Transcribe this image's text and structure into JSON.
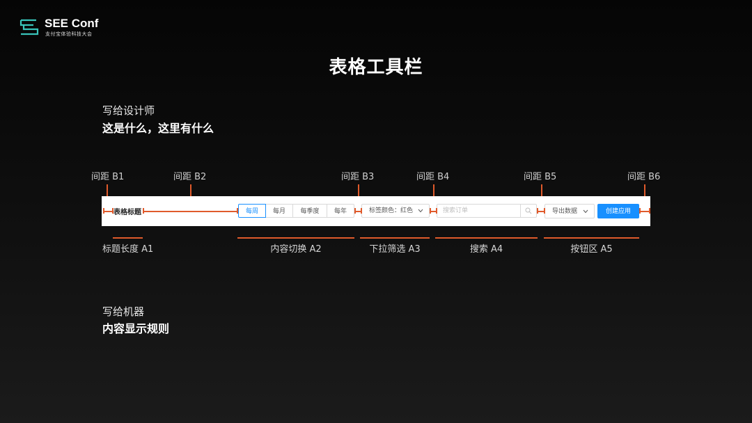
{
  "brand": {
    "name": "SEE Conf",
    "subtitle": "支付宝体验科技大会"
  },
  "page_title": "表格工具栏",
  "section1": {
    "caption": "写给设计师",
    "heading": "这是什么，这里有什么"
  },
  "section2": {
    "caption": "写给机器",
    "heading": "内容显示规则"
  },
  "spacing_labels": [
    "间距 B1",
    "间距 B2",
    "间距 B3",
    "间距 B4",
    "间距 B5",
    "间距 B6"
  ],
  "area_labels": [
    "标题长度 A1",
    "内容切换 A2",
    "下拉筛选 A3",
    "搜索 A4",
    "按钮区 A5"
  ],
  "toolbar": {
    "title": "表格标题",
    "segments": [
      "每周",
      "每月",
      "每季度",
      "每年"
    ],
    "active_segment": "每周",
    "filter_label": "标签颜色：",
    "filter_value": "红色",
    "search_placeholder": "搜索订单",
    "export_label": "导出数据",
    "create_label": "创建应用"
  },
  "colors": {
    "accent": "#e05a2b",
    "primary": "#1890ff",
    "logo": "#39c5bb"
  }
}
